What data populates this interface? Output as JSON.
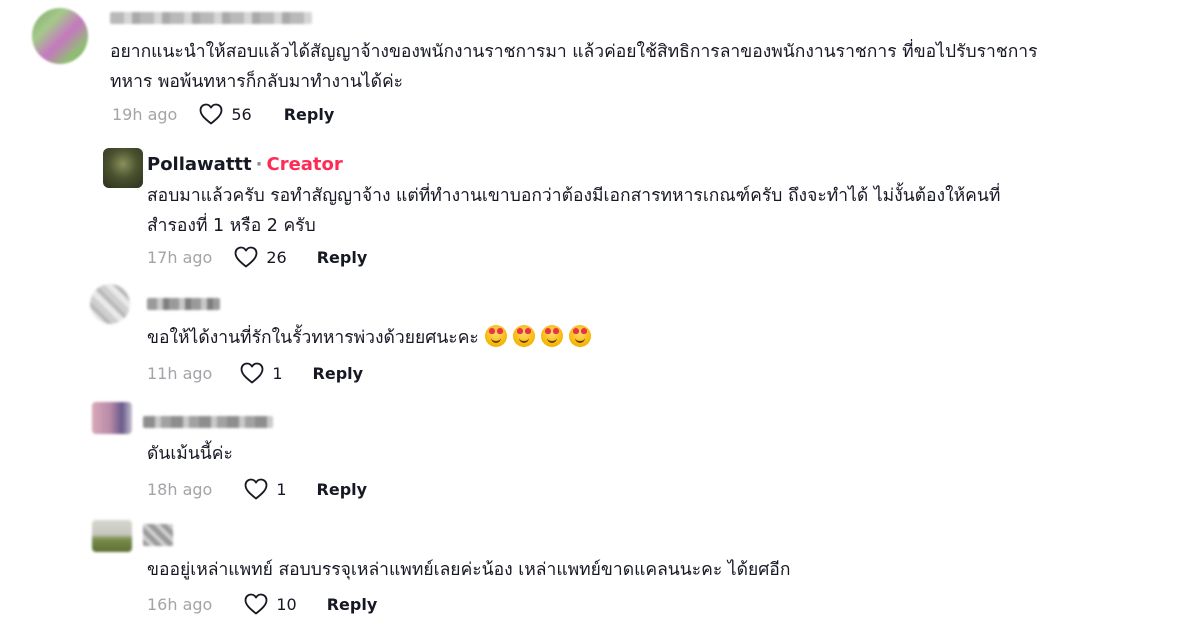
{
  "comments": [
    {
      "name": "",
      "is_creator": false,
      "text_lines": [
        "อยากแนะนำให้สอบแล้วได้สัญญาจ้างของพนักงานราชการมา แล้วค่อยใช้สิทธิการลาของพนักงานราชการ ที่ขอไปรับราชการ",
        "ทหาร พอพ้นทหารก็กลับมาทำงานได้ค่ะ"
      ],
      "time": "19h ago",
      "likes": "56",
      "reply": "Reply"
    },
    {
      "name": "Pollawattt",
      "dot": "·",
      "creator_label": "Creator",
      "is_creator": true,
      "text_lines": [
        "สอบมาแล้วครับ รอทำสัญญาจ้าง แต่ที่ทำงานเขาบอกว่าต้องมีเอกสารทหารเกณฑ์ครับ ถึงจะทำได้ ไม่งั้นต้องให้คนที่",
        "สำรองที่ 1 หรือ 2 ครับ"
      ],
      "time": "17h ago",
      "likes": "26",
      "reply": "Reply"
    },
    {
      "name": "",
      "is_creator": false,
      "text_lines": [
        "ขอให้ได้งานที่รักในรั้วทหารพ่วงด้วยยศนะคะ"
      ],
      "emoji_count": 4,
      "time": "11h ago",
      "likes": "1",
      "reply": "Reply"
    },
    {
      "name": "",
      "is_creator": false,
      "text_lines": [
        "ดันเม้นนี้ค่ะ"
      ],
      "time": "18h ago",
      "likes": "1",
      "reply": "Reply"
    },
    {
      "name": "",
      "is_creator": false,
      "text_lines": [
        "ขออยู่เหล่าแพทย์ สอบบรรจุเหล่าแพทย์เลยค่ะน้อง เหล่าแพทย์ขาดแคลนนะคะ ได้ยศอีก"
      ],
      "time": "16h ago",
      "likes": "10",
      "reply": "Reply"
    }
  ],
  "icons": {
    "like": "heart-outline-icon",
    "emoji": "smiling-face-with-hearts-icon"
  },
  "colors": {
    "creator": "#fe2c55",
    "meta": "#8a8b91",
    "text": "#161823"
  }
}
